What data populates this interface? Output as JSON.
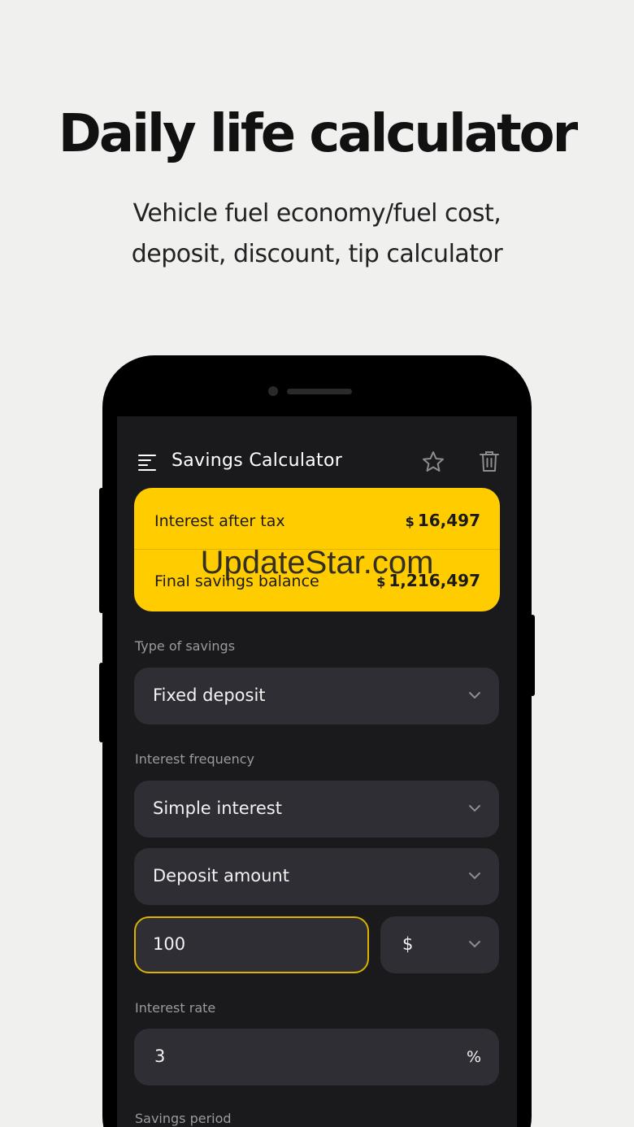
{
  "promo": {
    "headline": "Daily life calculator",
    "subline_1": "Vehicle fuel economy/fuel cost,",
    "subline_2": "deposit, discount, tip calculator"
  },
  "appbar": {
    "title": "Savings Calculator",
    "menu_icon": "menu-icon",
    "favorite_icon": "star-icon",
    "delete_icon": "trash-icon"
  },
  "results": {
    "interest_label": "Interest after tax",
    "interest_currency": "$",
    "interest_value": "16,497",
    "balance_label": "Final savings balance",
    "balance_currency": "$",
    "balance_value": "1,216,497"
  },
  "form": {
    "type_label": "Type of savings",
    "type_value": "Fixed deposit",
    "frequency_label": "Interest frequency",
    "frequency_value": "Simple interest",
    "amount_mode_value": "Deposit amount",
    "amount_value": "100",
    "currency_value": "$",
    "rate_label": "Interest rate",
    "rate_value": "3",
    "rate_unit": "%",
    "period_label": "Savings period"
  },
  "watermark": "UpdateStar.com",
  "colors": {
    "accent": "#ffcc00",
    "screen_bg": "#1a1a1c",
    "field_bg": "#2e2e34",
    "page_bg": "#f0f0ef"
  }
}
